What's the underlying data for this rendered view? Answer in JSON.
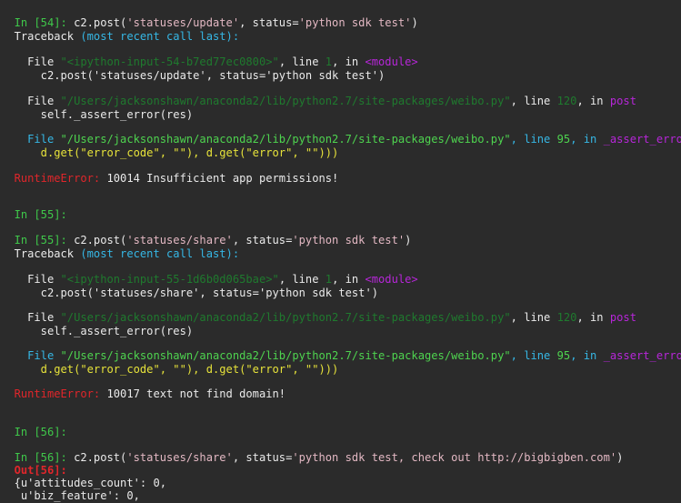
{
  "cells": {
    "in54": {
      "prompt": "In [54]:",
      "code_pre": " c2.post(",
      "code_str1": "'statuses/update'",
      "code_mid": ", status=",
      "code_str2": "'python sdk test'",
      "code_post": ")"
    },
    "tb1": {
      "traceback": "Traceback",
      "mrc": " (most recent call last):",
      "frame1": {
        "file_kw": "  File ",
        "file_path": "\"<ipython-input-54-b7ed77ec0800>\"",
        "line_kw": ", line ",
        "line_no": "1",
        "in_kw": ", in ",
        "func": "<module>",
        "src": "    c2.post('statuses/update', status='python sdk test')"
      },
      "frame2": {
        "file_kw": "  File ",
        "file_path": "\"/Users/jacksonshawn/anaconda2/lib/python2.7/site-packages/weibo.py\"",
        "line_kw": ", line ",
        "line_no": "120",
        "in_kw": ", in ",
        "func": "post",
        "src": "    self._assert_error(res)"
      },
      "frame3": {
        "file_kw": "  File ",
        "file_path": "\"/Users/jacksonshawn/anaconda2/lib/python2.7/site-packages/weibo.py\"",
        "line_kw": ", line ",
        "line_no": "95",
        "in_kw": ", in ",
        "func": "_assert_error",
        "src": "    d.get(\"error_code\", \"\"), d.get(\"error\", \"\")))"
      },
      "error_name": "RuntimeError:",
      "error_msg": " 10014 Insufficient app permissions!"
    },
    "in55a": {
      "prompt": "In [55]:"
    },
    "in55b": {
      "prompt": "In [55]:",
      "code_pre": " c2.post(",
      "code_str1": "'statuses/share'",
      "code_mid": ", status=",
      "code_str2": "'python sdk test'",
      "code_post": ")"
    },
    "tb2": {
      "traceback": "Traceback",
      "mrc": " (most recent call last):",
      "frame1": {
        "file_kw": "  File ",
        "file_path": "\"<ipython-input-55-1d6b0d065bae>\"",
        "line_kw": ", line ",
        "line_no": "1",
        "in_kw": ", in ",
        "func": "<module>",
        "src": "    c2.post('statuses/share', status='python sdk test')"
      },
      "frame2": {
        "file_kw": "  File ",
        "file_path": "\"/Users/jacksonshawn/anaconda2/lib/python2.7/site-packages/weibo.py\"",
        "line_kw": ", line ",
        "line_no": "120",
        "in_kw": ", in ",
        "func": "post",
        "src": "    self._assert_error(res)"
      },
      "frame3": {
        "file_kw": "  File ",
        "file_path": "\"/Users/jacksonshawn/anaconda2/lib/python2.7/site-packages/weibo.py\"",
        "line_kw": ", line ",
        "line_no": "95",
        "in_kw": ", in ",
        "func": "_assert_error",
        "src": "    d.get(\"error_code\", \"\"), d.get(\"error\", \"\")))"
      },
      "error_name": "RuntimeError:",
      "error_msg": " 10017 text not find domain!"
    },
    "in56a": {
      "prompt": "In [56]:"
    },
    "in56b": {
      "prompt": "In [56]:",
      "code_pre": " c2.post(",
      "code_str1": "'statuses/share'",
      "code_mid": ", status=",
      "code_str2": "'python sdk test, check out http://bigbigben.com'",
      "code_post": ")"
    },
    "out56": {
      "prompt": "Out[56]:",
      "lines": [
        "{u'attitudes_count': 0,",
        " u'biz_feature': 0,"
      ]
    }
  }
}
